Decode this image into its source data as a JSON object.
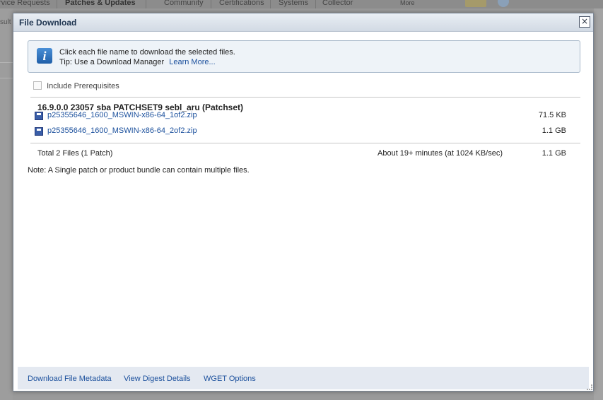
{
  "background": {
    "tabs": [
      "rvice Requests",
      "Patches & Updates",
      "Community",
      "Certifications",
      "Systems",
      "Collector",
      "More"
    ],
    "left_text": "sult"
  },
  "dialog": {
    "title": "File Download",
    "close_label": "×",
    "info": {
      "icon": "info-icon",
      "icon_glyph": "i",
      "line1": "Click each file name to download the selected files.",
      "line2_prefix": "Tip: Use a Download Manager",
      "learn_more": "Learn More..."
    },
    "include_prerequisites": {
      "label": "Include Prerequisites",
      "checked": false
    },
    "patch": {
      "title": "16.9.0.0 23057 sba PATCHSET9 sebl_aru (Patchset)",
      "files": [
        {
          "name": "p25355646_1600_MSWIN-x86-64_1of2.zip",
          "size": "71.5 KB"
        },
        {
          "name": "p25355646_1600_MSWIN-x86-64_2of2.zip",
          "size": "1.1 GB"
        }
      ]
    },
    "totals": {
      "count": "Total 2 Files (1 Patch)",
      "time": "About 19+ minutes (at 1024 KB/sec)",
      "size": "1.1 GB"
    },
    "note": "Note: A Single patch or product bundle can contain multiple files.",
    "footer": {
      "metadata": "Download File Metadata",
      "digest": "View Digest Details",
      "wget": "WGET Options"
    }
  },
  "colors": {
    "accent_link": "#1a4f9c",
    "header_bg": "#d2dae4",
    "info_bg": "#eef3f8",
    "footer_bg": "#e4e9f1"
  }
}
